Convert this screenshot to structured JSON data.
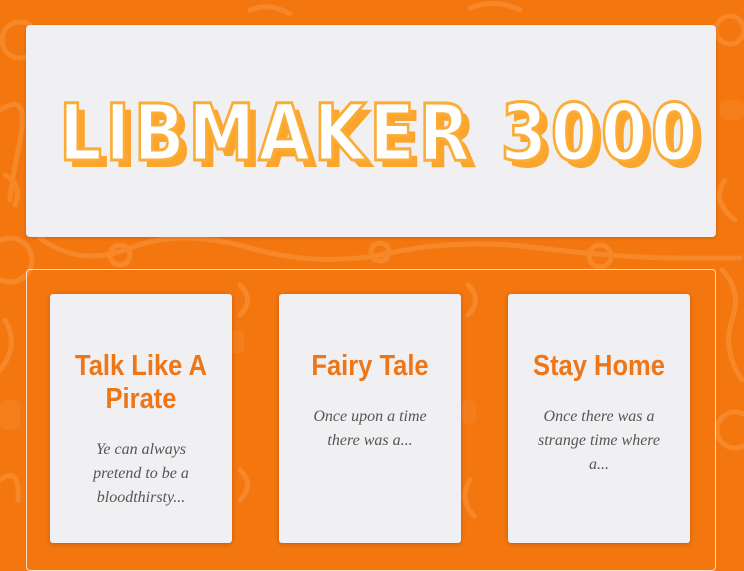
{
  "colors": {
    "background": "#f3760f",
    "card_background": "#f0eff2",
    "title_orange": "#ee7616",
    "logo_orange": "#fba52c"
  },
  "hero": {
    "logo_text": "LIBMAKER 3000"
  },
  "cards": [
    {
      "title": "Talk Like A Pirate",
      "description": "Ye can always pretend to be a bloodthirsty..."
    },
    {
      "title": "Fairy Tale",
      "description": "Once upon a time there was a..."
    },
    {
      "title": "Stay Home",
      "description": "Once there was a strange time where a..."
    }
  ]
}
